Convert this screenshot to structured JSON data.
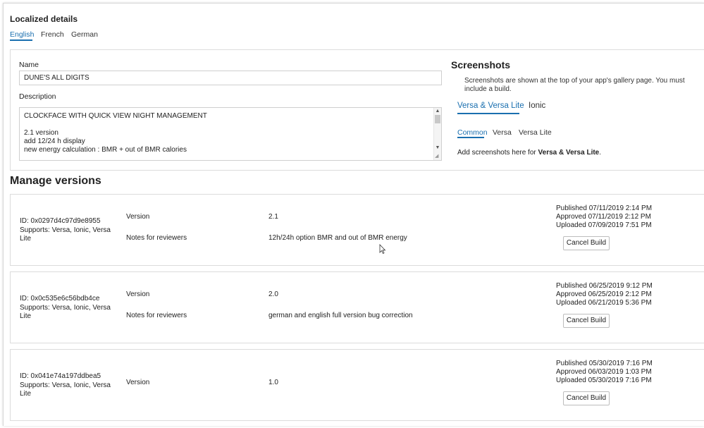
{
  "localized": {
    "title": "Localized details",
    "languages": [
      "English",
      "French",
      "German"
    ],
    "name_label": "Name",
    "name_value": "DUNE'S ALL DIGITS",
    "description_label": "Description",
    "description_lines": [
      "CLOCKFACE WITH QUICK VIEW NIGHT MANAGEMENT",
      "",
      "2.1 version",
      "add 12/24 h display",
      "new energy calculation : BMR + out of BMR calories"
    ]
  },
  "screenshots": {
    "title": "Screenshots",
    "description": "Screenshots are shown at the top of your app's gallery page. You must include a build.",
    "device_tabs": [
      "Versa & Versa Lite",
      "Ionic"
    ],
    "sub_tabs": [
      "Common",
      "Versa",
      "Versa Lite"
    ],
    "add_text_prefix": "Add screenshots here for ",
    "add_text_bold": "Versa & Versa Lite",
    "add_text_suffix": "."
  },
  "manage": {
    "title": "Manage versions",
    "version_label": "Version",
    "notes_label": "Notes for reviewers",
    "cancel_label": "Cancel Build",
    "versions": [
      {
        "id": "ID: 0x0297d4c97d9e8955",
        "supports": "Supports: Versa, Ionic, Versa Lite",
        "version": "2.1",
        "notes": "12h/24h option BMR and out of BMR energy",
        "published": "Published 07/11/2019 2:14 PM",
        "approved": "Approved 07/11/2019 2:12 PM",
        "uploaded": "Uploaded 07/09/2019 7:51 PM"
      },
      {
        "id": "ID: 0x0c535e6c56bdb4ce",
        "supports": "Supports: Versa, Ionic, Versa Lite",
        "version": "2.0",
        "notes": "german and english full version bug correction",
        "published": "Published 06/25/2019 9:12 PM",
        "approved": "Approved 06/25/2019 2:12 PM",
        "uploaded": "Uploaded 06/21/2019 5:36 PM"
      },
      {
        "id": "ID: 0x041e74a197ddbea5",
        "supports": "Supports: Versa, Ionic, Versa Lite",
        "version": "1.0",
        "published": "Published 05/30/2019 7:16 PM",
        "approved": "Approved 06/03/2019 1:03 PM",
        "uploaded": "Uploaded 05/30/2019 7:16 PM"
      }
    ]
  },
  "colors": {
    "accent": "#1a6faf",
    "border": "#dcdcdc"
  }
}
